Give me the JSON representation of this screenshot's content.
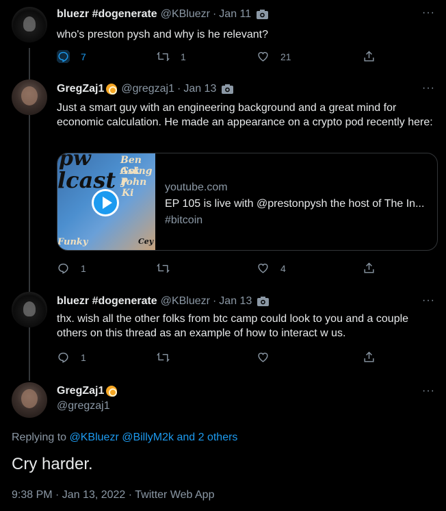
{
  "tweets": [
    {
      "name": "bluezr #dogenerate",
      "handle": "@KBluezr",
      "date": "Jan 11",
      "text": "who's preston pysh and why is he relevant?",
      "reply_count": "7",
      "retweet_count": "1",
      "like_count": "21"
    },
    {
      "name": "GregZaj1",
      "handle": "@gregzaj1",
      "date": "Jan 13",
      "text": "Just a smart guy with an engineering background and a great mind for economic calculation.  He made an appearance on a crypto pod recently here:",
      "card": {
        "domain": "youtube.com",
        "title": "EP 105 is live with @prestonpysh the host of The In...",
        "description": "#bitcoin",
        "thumb_texts": [
          "pw",
          "lcast",
          "Ben Ask",
          "Going P",
          "John Ki",
          "Funky",
          "Cey"
        ]
      },
      "reply_count": "1",
      "retweet_count": "",
      "like_count": "4"
    },
    {
      "name": "bluezr #dogenerate",
      "handle": "@KBluezr",
      "date": "Jan 13",
      "text": "thx. wish all the other folks from btc camp could look to you and a couple others on this thread as an example of how to interact w us.",
      "reply_count": "1",
      "retweet_count": "",
      "like_count": ""
    }
  ],
  "focus": {
    "name": "GregZaj1",
    "handle": "@gregzaj1",
    "replying_prefix": "Replying to",
    "replying_users": "@KBluezr @BillyM2k",
    "replying_and": "and 2 others",
    "text": "Cry harder.",
    "meta": "9:38 PM · Jan 13, 2022 · Twitter Web App"
  },
  "ui": {
    "dot": "·",
    "more": "···"
  },
  "colors": {
    "accent": "#1d9bf0",
    "muted": "#8b98a5",
    "background": "#000000",
    "badge": "#f5a623"
  }
}
